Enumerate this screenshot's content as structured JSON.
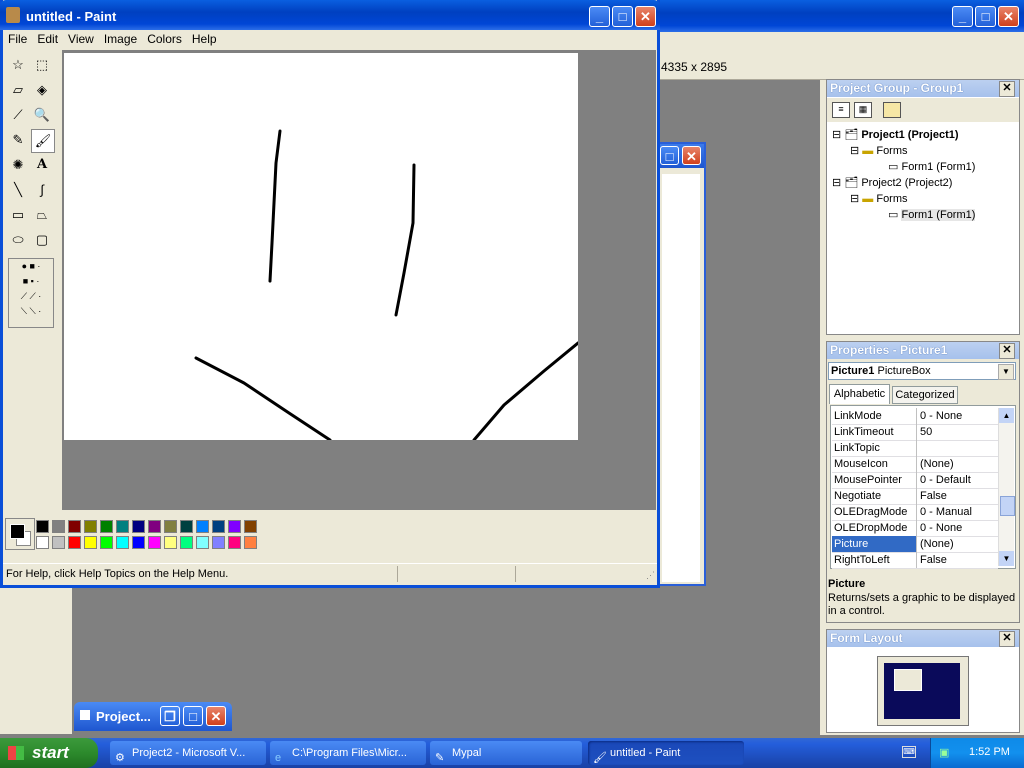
{
  "paint": {
    "title": "untitled - Paint",
    "menu": [
      "File",
      "Edit",
      "View",
      "Image",
      "Colors",
      "Help"
    ],
    "status": "For Help, click Help Topics on the Help Menu.",
    "palette_top": [
      "#000000",
      "#808080",
      "#800000",
      "#808000",
      "#008000",
      "#008080",
      "#000080",
      "#800080",
      "#808040",
      "#004040",
      "#0080ff",
      "#004080",
      "#8000ff",
      "#804000"
    ],
    "palette_bottom": [
      "#ffffff",
      "#c0c0c0",
      "#ff0000",
      "#ffff00",
      "#00ff00",
      "#00ffff",
      "#0000ff",
      "#ff00ff",
      "#ffff80",
      "#00ff80",
      "#80ffff",
      "#8080ff",
      "#ff0080",
      "#ff8040"
    ],
    "primary_color": "#000000",
    "secondary_color": "#ffffff"
  },
  "vb": {
    "coords": "4335 x 2895",
    "project_group": {
      "title": "Project Group - Group1",
      "tree": [
        {
          "label": "Project1 (Project1)",
          "bold": true
        },
        {
          "label": "Forms"
        },
        {
          "label": "Form1 (Form1)"
        },
        {
          "label": "Project2 (Project2)"
        },
        {
          "label": "Forms"
        },
        {
          "label": "Form1 (Form1)"
        }
      ]
    },
    "properties": {
      "title": "Properties - Picture1",
      "object_name": "Picture1",
      "object_type": "PictureBox",
      "tab_alpha": "Alphabetic",
      "tab_cat": "Categorized",
      "rows": [
        {
          "name": "LinkMode",
          "value": "0 - None"
        },
        {
          "name": "LinkTimeout",
          "value": "50"
        },
        {
          "name": "LinkTopic",
          "value": ""
        },
        {
          "name": "MouseIcon",
          "value": "(None)"
        },
        {
          "name": "MousePointer",
          "value": "0 - Default"
        },
        {
          "name": "Negotiate",
          "value": "False"
        },
        {
          "name": "OLEDragMode",
          "value": "0 - Manual"
        },
        {
          "name": "OLEDropMode",
          "value": "0 - None"
        },
        {
          "name": "Picture",
          "value": "(None)"
        },
        {
          "name": "RightToLeft",
          "value": "False"
        }
      ],
      "desc_title": "Picture",
      "desc_text": "Returns/sets a graphic to be displayed in a control."
    },
    "form_layout": {
      "title": "Form Layout"
    },
    "minimized": {
      "title": "Project..."
    }
  },
  "taskbar": {
    "start": "start",
    "items": [
      {
        "label": "Project2 - Microsoft V..."
      },
      {
        "label": "C:\\Program Files\\Micr..."
      },
      {
        "label": "Mypal"
      },
      {
        "label": "untitled - Paint"
      }
    ],
    "clock": "1:52 PM"
  }
}
